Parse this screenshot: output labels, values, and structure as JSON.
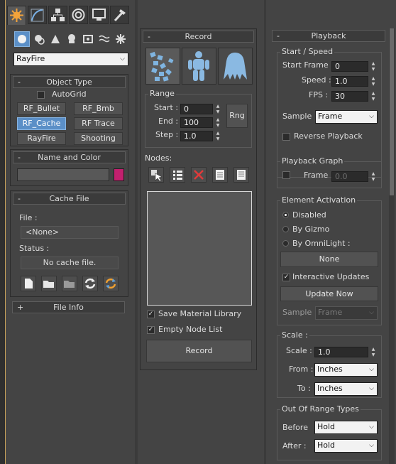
{
  "top_tabs": [
    "create-icon",
    "modify-icon",
    "hierarchy-icon",
    "motion-icon",
    "display-icon",
    "utilities-icon"
  ],
  "create": {
    "category_icons": [
      "geometry-icon",
      "shapes-icon",
      "lights-icon",
      "cameras-icon",
      "helpers-icon",
      "spacewarps-icon",
      "systems-icon"
    ],
    "dropdown": "RayFire",
    "object_type": {
      "title": "Object Type",
      "autogrid": "AutoGrid",
      "buttons": [
        "RF_Bullet",
        "RF_Bmb",
        "RF_Cache",
        "RF Trace",
        "RayFire",
        "Shooting"
      ],
      "selected": "RF_Cache"
    },
    "name_color": {
      "title": "Name and Color",
      "swatch": "#c2206e"
    },
    "cache_file": {
      "title": "Cache File",
      "file_label": "File :",
      "file_value": "<None>",
      "status_label": "Status :",
      "status_value": "No cache file."
    },
    "file_info": {
      "sign": "+",
      "title": "File Info"
    }
  },
  "record": {
    "sign": "-",
    "title": "Record",
    "range": {
      "title": "Range",
      "start_label": "Start :",
      "start": "0",
      "end_label": "End :",
      "end": "100",
      "step_label": "Step :",
      "step": "1.0",
      "rng": "Rng"
    },
    "nodes_label": "Nodes:",
    "save_material": "Save Material Library",
    "empty_node": "Empty Node List",
    "button": "Record"
  },
  "playback": {
    "sign": "-",
    "title": "Playback",
    "start_speed": {
      "title": "Start / Speed",
      "start_frame_label": "Start Frame :",
      "start_frame": "0",
      "speed_label": "Speed :",
      "speed": "1.0",
      "fps_label": "FPS :",
      "fps": "30"
    },
    "sample_label": "Sample :",
    "sample": "Frame",
    "reverse": "Reverse Playback",
    "graph": {
      "title": "Playback Graph",
      "frame_label": "Frame :",
      "frame": "0.0"
    },
    "element": {
      "title": "Element Activation",
      "disabled": "Disabled",
      "by_gizmo": "By Gizmo",
      "by_omni": "By OmniLight :",
      "none": "None",
      "interactive": "Interactive Updates",
      "update_now": "Update Now",
      "sample_label": "Sample :",
      "sample": "Frame"
    },
    "scale": {
      "title": "Scale :",
      "scale_label": "Scale :",
      "scale": "1.0",
      "from_label": "From :",
      "from": "Inches",
      "to_label": "To :",
      "to": "Inches"
    },
    "out_of_range": {
      "title": "Out Of Range Types",
      "before_label": "Before",
      "before": "Hold",
      "after_label": "After :",
      "after": "Hold"
    }
  }
}
